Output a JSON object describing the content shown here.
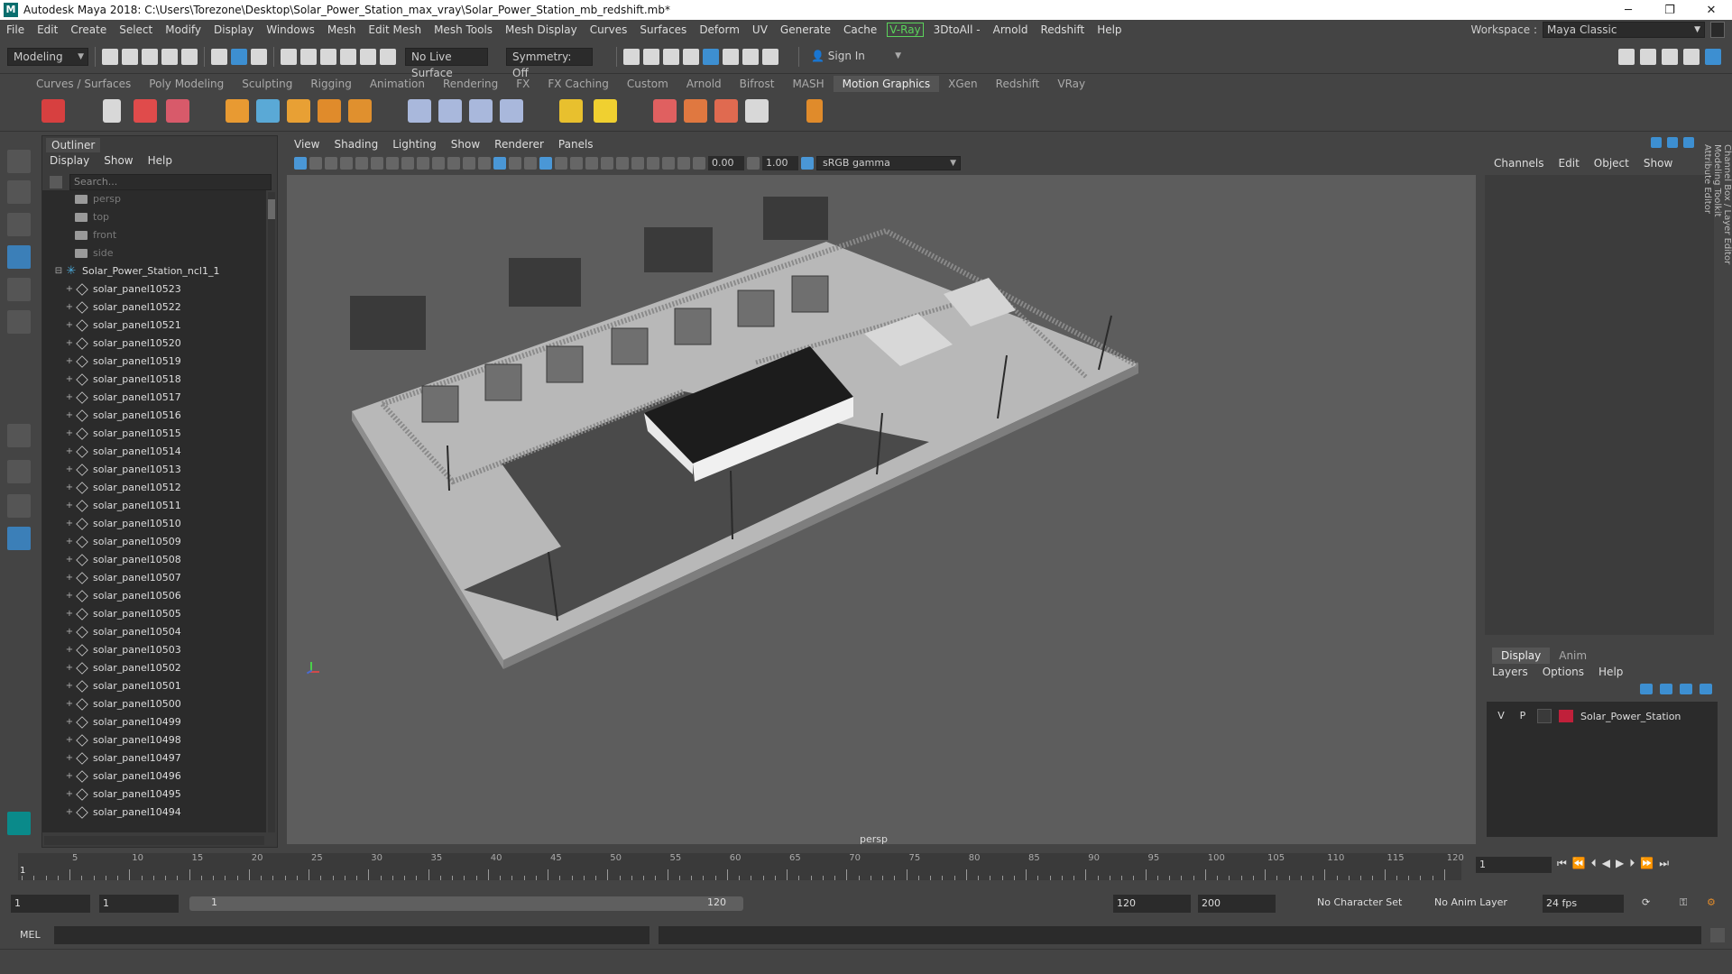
{
  "window": {
    "title": "Autodesk Maya 2018: C:\\Users\\Torezone\\Desktop\\Solar_Power_Station_max_vray\\Solar_Power_Station_mb_redshift.mb*",
    "logo": "M"
  },
  "menubar": [
    "File",
    "Edit",
    "Create",
    "Select",
    "Modify",
    "Display",
    "Windows",
    "Mesh",
    "Edit Mesh",
    "Mesh Tools",
    "Mesh Display",
    "Curves",
    "Surfaces",
    "Deform",
    "UV",
    "Generate",
    "Cache"
  ],
  "menubar_vray": "V-Ray",
  "menubar_after": [
    "3DtoAll -",
    "Arnold",
    "Redshift",
    "Help"
  ],
  "workspace": {
    "label": "Workspace :",
    "value": "Maya Classic"
  },
  "statusline": {
    "mode": "Modeling",
    "live_surface": "No Live Surface",
    "symmetry": "Symmetry: Off",
    "sign_in": "Sign In"
  },
  "shelf_tabs": [
    "Curves / Surfaces",
    "Poly Modeling",
    "Sculpting",
    "Rigging",
    "Animation",
    "Rendering",
    "FX",
    "FX Caching",
    "Custom",
    "Arnold",
    "Bifrost",
    "MASH",
    "Motion Graphics",
    "XGen",
    "Redshift",
    "VRay"
  ],
  "shelf_active": "Motion Graphics",
  "outliner": {
    "tab": "Outliner",
    "menu": [
      "Display",
      "Show",
      "Help"
    ],
    "search_placeholder": "Search...",
    "cameras": [
      "persp",
      "top",
      "front",
      "side"
    ],
    "group": "Solar_Power_Station_ncl1_1",
    "items": [
      "solar_panel10523",
      "solar_panel10522",
      "solar_panel10521",
      "solar_panel10520",
      "solar_panel10519",
      "solar_panel10518",
      "solar_panel10517",
      "solar_panel10516",
      "solar_panel10515",
      "solar_panel10514",
      "solar_panel10513",
      "solar_panel10512",
      "solar_panel10511",
      "solar_panel10510",
      "solar_panel10509",
      "solar_panel10508",
      "solar_panel10507",
      "solar_panel10506",
      "solar_panel10505",
      "solar_panel10504",
      "solar_panel10503",
      "solar_panel10502",
      "solar_panel10501",
      "solar_panel10500",
      "solar_panel10499",
      "solar_panel10498",
      "solar_panel10497",
      "solar_panel10496",
      "solar_panel10495",
      "solar_panel10494"
    ]
  },
  "viewport": {
    "menu": [
      "View",
      "Shading",
      "Lighting",
      "Show",
      "Renderer",
      "Panels"
    ],
    "field1": "0.00",
    "field2": "1.00",
    "color_space": "sRGB gamma",
    "camera_label": "persp"
  },
  "channelbox": {
    "menu": [
      "Channels",
      "Edit",
      "Object",
      "Show"
    ],
    "side_tabs": [
      "Channel Box / Layer Editor",
      "Modeling Toolkit",
      "Attribute Editor"
    ]
  },
  "layer_editor": {
    "tabs": [
      "Display",
      "Anim"
    ],
    "active_tab": "Display",
    "menu": [
      "Layers",
      "Options",
      "Help"
    ],
    "layer": {
      "v": "V",
      "p": "P",
      "name": "Solar_Power_Station",
      "color": "#c0203a"
    }
  },
  "timeline": {
    "ticks": [
      5,
      10,
      15,
      20,
      25,
      30,
      35,
      40,
      45,
      50,
      55,
      60,
      65,
      70,
      75,
      80,
      85,
      90,
      95,
      100,
      105,
      110,
      115,
      120
    ],
    "current_marker": "1",
    "current_frame": "1"
  },
  "range": {
    "start": "1",
    "start_inner": "1",
    "slider_start": "1",
    "slider_end": "120",
    "end": "120",
    "anim_end": "200",
    "character_set": "No Character Set",
    "anim_layer": "No Anim Layer",
    "fps": "24 fps"
  },
  "cmdline": {
    "label": "MEL"
  }
}
